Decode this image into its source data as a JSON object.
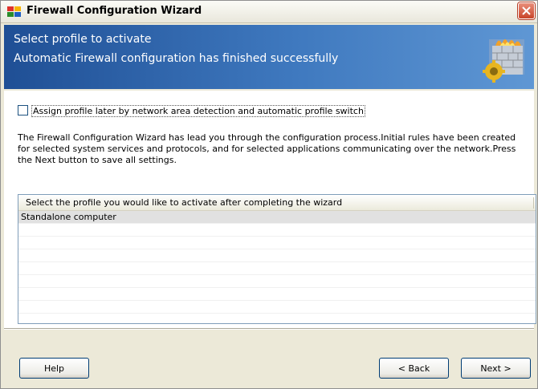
{
  "window": {
    "title": "Firewall Configuration Wizard",
    "icon": "avg-firewall-icon"
  },
  "banner": {
    "title": "Select profile to activate",
    "subtitle": "Automatic Firewall configuration has finished successfully",
    "art": "firewall-gear-icon"
  },
  "checkbox": {
    "label": "Assign profile later by network area detection and automatic profile switch",
    "checked": false
  },
  "description": "The Firewall Configuration Wizard has lead you through the configuration process.Initial rules have been created for selected system services and protocols, and for selected applications communicating over the network.Press the Next button to save all settings.",
  "profile_list": {
    "header": "Select the profile you would like to activate after completing the wizard",
    "items": [
      "Standalone computer"
    ]
  },
  "buttons": {
    "help": "Help",
    "back": "< Back",
    "next": "Next >"
  },
  "colors": {
    "banner_start": "#1f4f95",
    "banner_end": "#5f97d4",
    "window_bg": "#ece9d8",
    "close_button": "#c8442a"
  }
}
